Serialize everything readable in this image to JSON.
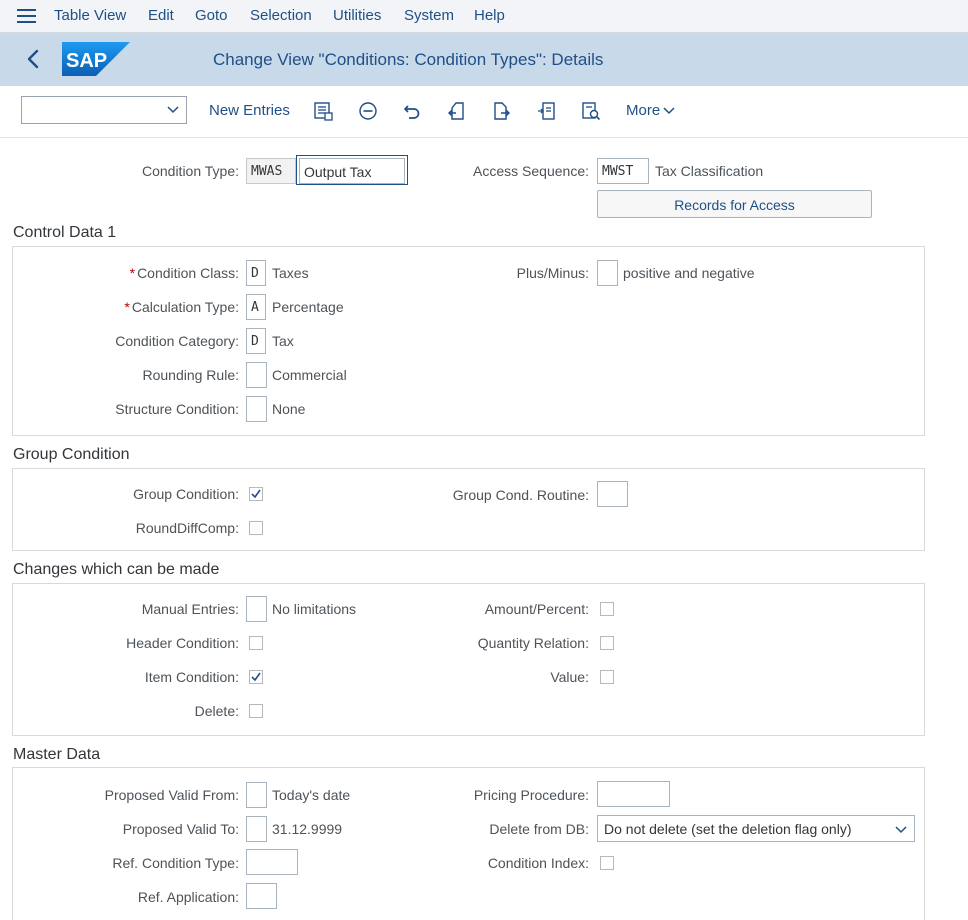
{
  "menu": [
    "Table View",
    "Edit",
    "Goto",
    "Selection",
    "Utilities",
    "System",
    "Help"
  ],
  "title": "Change View \"Conditions: Condition Types\": Details",
  "logo_text": "SAP",
  "toolbar": {
    "new_entries": "New Entries",
    "more": "More",
    "icons": [
      "save-list-icon",
      "minus-circle-icon",
      "undo-icon",
      "previous-entry-icon",
      "next-entry-icon",
      "select-all-icon",
      "search-list-icon"
    ]
  },
  "header": {
    "condition_type_label": "Condition Type:",
    "condition_type_code": "MWAS",
    "condition_type_name": "Output Tax",
    "access_seq_label": "Access Sequence:",
    "access_seq_code": "MWST",
    "access_seq_desc": "Tax Classification",
    "records_button": "Records for Access"
  },
  "control_data": {
    "title": "Control Data 1",
    "condition_class": {
      "label": "Condition Class:",
      "value": "D",
      "desc": "Taxes",
      "required": "*"
    },
    "calculation_type": {
      "label": "Calculation Type:",
      "value": "A",
      "desc": "Percentage",
      "required": "*"
    },
    "condition_category": {
      "label": "Condition Category:",
      "value": "D",
      "desc": "Tax"
    },
    "rounding_rule": {
      "label": "Rounding Rule:",
      "value": "",
      "desc": "Commercial"
    },
    "structure_condition": {
      "label": "Structure Condition:",
      "value": "",
      "desc": "None"
    },
    "plus_minus": {
      "label": "Plus/Minus:",
      "value": "",
      "desc": "positive and negative"
    }
  },
  "group_condition": {
    "title": "Group Condition",
    "group_condition": {
      "label": "Group Condition:",
      "checked": true
    },
    "round_diff": {
      "label": "RoundDiffComp:",
      "checked": false
    },
    "routine": {
      "label": "Group Cond. Routine:",
      "value": ""
    }
  },
  "changes": {
    "title": "Changes which can be made",
    "manual_entries": {
      "label": "Manual Entries:",
      "value": "",
      "desc": "No limitations"
    },
    "header_condition": {
      "label": "Header Condition:",
      "checked": false
    },
    "item_condition": {
      "label": "Item Condition:",
      "checked": true
    },
    "delete": {
      "label": "Delete:",
      "checked": false
    },
    "amount_percent": {
      "label": "Amount/Percent:",
      "checked": false
    },
    "quantity_relation": {
      "label": "Quantity Relation:",
      "checked": false
    },
    "value": {
      "label": "Value:",
      "checked": false
    }
  },
  "master_data": {
    "title": "Master Data",
    "valid_from": {
      "label": "Proposed Valid From:",
      "value": "",
      "desc": "Today's date"
    },
    "valid_to": {
      "label": "Proposed Valid To:",
      "value": "",
      "desc": "31.12.9999"
    },
    "ref_condition_type": {
      "label": "Ref. Condition Type:",
      "value": ""
    },
    "ref_application": {
      "label": "Ref. Application:",
      "value": ""
    },
    "pricing_procedure": {
      "label": "Pricing Procedure:",
      "value": ""
    },
    "delete_from_db": {
      "label": "Delete from DB:",
      "value": "Do not delete (set the deletion flag only)"
    },
    "condition_index": {
      "label": "Condition Index:",
      "checked": false
    }
  },
  "colors": {
    "link": "#1f4f87",
    "titlebar": "#c8d9ea",
    "menubar": "#f2f4f7",
    "required": "#bb0000",
    "sap_blue": "#0a6ed1"
  }
}
